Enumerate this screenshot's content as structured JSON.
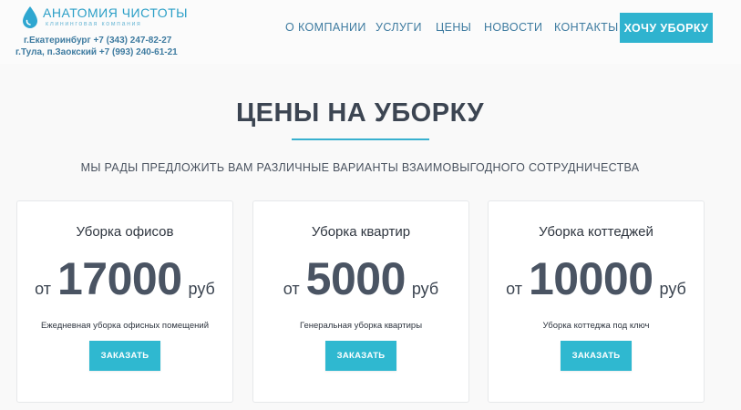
{
  "colors": {
    "accent": "#2fb3cf",
    "nav_text": "#3e7ba0",
    "heading": "#3c4552",
    "background": "#f9f9f9",
    "card_bg": "#ffffff"
  },
  "header": {
    "logo": {
      "icon": "water-drop-icon",
      "name": "АНАТОМИЯ ЧИСТОТЫ",
      "tagline": "клининговая компания"
    },
    "phones": [
      "г.Екатеринбург +7 (343) 247-82-27",
      "г.Тула, п.Заокский +7 (993) 240-61-21"
    ],
    "nav": [
      "О КОМПАНИИ",
      "УСЛУГИ",
      "ЦЕНЫ",
      "НОВОСТИ",
      "КОНТАКТЫ"
    ],
    "cta": "ХОЧУ УБОРКУ"
  },
  "section": {
    "title": "ЦЕНЫ НА УБОРКУ",
    "subtitle": "МЫ РАДЫ ПРЕДЛОЖИТЬ ВАМ РАЗЛИЧНЫЕ ВАРИАНТЫ ВЗАИМОВЫГОДНОГО СОТРУДНИЧЕСТВА"
  },
  "cards": [
    {
      "title": "Уборка офисов",
      "from": "от",
      "price": "17000",
      "currency": "руб",
      "description": "Ежедневная уборка офисных помещений",
      "button": "ЗАКАЗАТЬ"
    },
    {
      "title": "Уборка квартир",
      "from": "от",
      "price": "5000",
      "currency": "руб",
      "description": "Генеральная уборка квартиры",
      "button": "ЗАКАЗАТЬ"
    },
    {
      "title": "Уборка коттеджей",
      "from": "от",
      "price": "10000",
      "currency": "руб",
      "description": "Уборка коттеджа под ключ",
      "button": "ЗАКАЗАТЬ"
    }
  ]
}
